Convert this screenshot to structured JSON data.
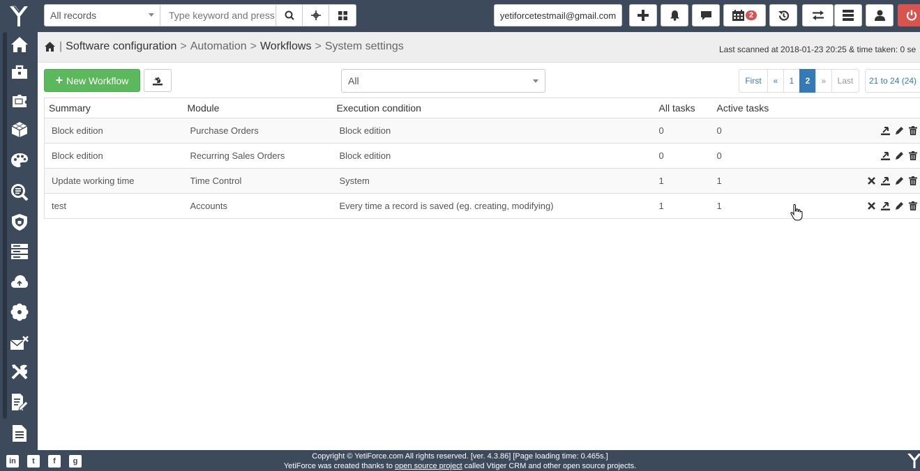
{
  "header": {
    "records_select": "All records",
    "search_placeholder": "Type keyword and press",
    "email": "yetiforcetestmail@gmail.com",
    "calendar_badge": "2"
  },
  "sidebar": {
    "items": [
      "home-icon",
      "briefcase-icon",
      "puzzle-icon",
      "cube-icon",
      "palette-icon",
      "search-doc-icon",
      "shield-icon",
      "server-icon",
      "cloud-icon",
      "gear-flower-icon",
      "mail-x-icon",
      "tools-icon",
      "edit-doc-icon",
      "document-icon"
    ]
  },
  "breadcrumb": {
    "part1": "Software configuration",
    "part2": "Automation",
    "part3": "Workflows",
    "part4": "System settings",
    "separator": ">",
    "pipe": "|"
  },
  "scan_info": "Last scanned at 2018-01-23 20:25 & time taken: 0 se",
  "toolbar": {
    "new_workflow_label": "New Workflow",
    "filter_value": "All"
  },
  "pagination": {
    "first": "First",
    "prev": "«",
    "page1": "1",
    "page2": "2",
    "next": "»",
    "last": "Last",
    "range": "21 to 24 (24)"
  },
  "table": {
    "headers": [
      "Summary",
      "Module",
      "Execution condition",
      "All tasks",
      "Active tasks"
    ],
    "rows": [
      {
        "summary": "Block edition",
        "module": "Purchase Orders",
        "condition": "Block edition",
        "all_tasks": "0",
        "active_tasks": "0",
        "has_delete_x": false
      },
      {
        "summary": "Block edition",
        "module": "Recurring Sales Orders",
        "condition": "Block edition",
        "all_tasks": "0",
        "active_tasks": "0",
        "has_delete_x": false
      },
      {
        "summary": "Update working time",
        "module": "Time Control",
        "condition": "System",
        "all_tasks": "1",
        "active_tasks": "1",
        "has_delete_x": true
      },
      {
        "summary": "test",
        "module": "Accounts",
        "condition": "Every time a record is saved (eg. creating, modifying)",
        "all_tasks": "1",
        "active_tasks": "1",
        "has_delete_x": true
      }
    ]
  },
  "footer": {
    "line1": "Copyright © YetiForce.com All rights reserved. [ver. 4.3.86] [Page loading time: 0.465s.]",
    "line2_pre": "YetiForce was created thanks to ",
    "line2_link": "open source project",
    "line2_post": " called Vtiger CRM and other open source projects.",
    "social": [
      "in",
      "t",
      "f",
      "g"
    ]
  },
  "colors": {
    "header_bg": "#3d4a5c",
    "accent_green": "#5cb85c",
    "accent_blue": "#337ab7",
    "danger": "#d9534f"
  }
}
